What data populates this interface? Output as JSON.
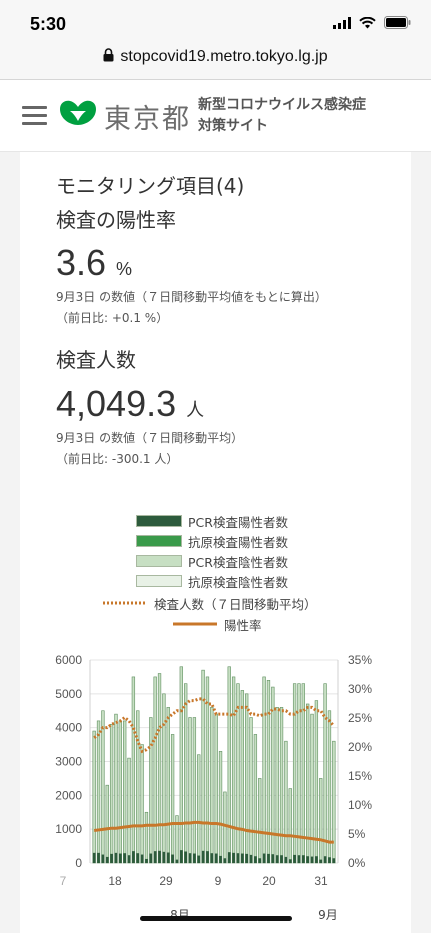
{
  "status": {
    "time": "5:30"
  },
  "browser": {
    "url": "stopcovid19.metro.tokyo.lg.jp"
  },
  "header": {
    "logo_text": "東京都",
    "site_title_line1": "新型コロナウイルス感染症",
    "site_title_line2": "対策サイト"
  },
  "card": {
    "section_title": "モニタリング項目(4)",
    "positive_rate": {
      "heading": "検査の陽性率",
      "value": "3.6",
      "unit": "%",
      "note1": "9月3日 の数値（７日間移動平均値をもとに算出）",
      "note2": "（前日比: +0.1 %）"
    },
    "tests": {
      "heading": "検査人数",
      "value": "4,049.3",
      "unit": "人",
      "note1": "9月3日 の数値（７日間移動平均）",
      "note2": "（前日比: -300.1 人）"
    }
  },
  "colors": {
    "pcr_positive": "#2d5b3c",
    "antigen_positive": "#3a9a4a",
    "pcr_negative": "#c7dfc3",
    "antigen_negative": "#e8f1e6",
    "tests_avg": "#c8772a",
    "positive_rate": "#c8772a"
  },
  "chart_data": {
    "type": "bar",
    "legend": [
      {
        "name": "PCR検査陽性者数",
        "kind": "bar",
        "color": "#2d5b3c"
      },
      {
        "name": "抗原検査陽性者数",
        "kind": "bar",
        "color": "#3a9a4a"
      },
      {
        "name": "PCR検査陰性者数",
        "kind": "bar",
        "color": "#c7dfc3"
      },
      {
        "name": "抗原検査陰性者数",
        "kind": "bar",
        "color": "#e8f1e6"
      },
      {
        "name": "検査人数（７日間移動平均）",
        "kind": "dotted-line",
        "color": "#c8772a"
      },
      {
        "name": "陽性率",
        "kind": "line",
        "color": "#c8772a"
      }
    ],
    "x_ticks": [
      "7",
      "18",
      "29",
      "9",
      "20",
      "31"
    ],
    "month_labels": [
      "8月",
      "9月"
    ],
    "y_left": {
      "min": 0,
      "max": 6000,
      "ticks": [
        "0",
        "1000",
        "2000",
        "3000",
        "4000",
        "5000",
        "6000"
      ]
    },
    "y_right": {
      "min": 0,
      "max": 35,
      "ticks": [
        "0%",
        "5%",
        "10%",
        "15%",
        "20%",
        "25%",
        "30%",
        "35%"
      ]
    },
    "daily_totals": [
      3900,
      4200,
      4500,
      2300,
      4100,
      4400,
      4200,
      4200,
      3100,
      5500,
      4500,
      3500,
      1500,
      4300,
      5500,
      5600,
      5000,
      4600,
      3800,
      1400,
      5800,
      5300,
      4300,
      4300,
      3200,
      5700,
      5500,
      4600,
      4400,
      3300,
      2100,
      5800,
      5500,
      5300,
      5100,
      5000,
      4300,
      3800,
      2500,
      5500,
      5400,
      5200,
      4600,
      4600,
      3600,
      2200,
      5300,
      5300,
      5300,
      4700,
      4400,
      4800,
      2500,
      5300,
      4500,
      3600
    ],
    "positives": [
      300,
      300,
      250,
      180,
      270,
      300,
      280,
      290,
      230,
      350,
      290,
      250,
      120,
      280,
      350,
      360,
      330,
      310,
      250,
      100,
      380,
      340,
      290,
      280,
      220,
      360,
      350,
      290,
      280,
      210,
      140,
      320,
      300,
      290,
      280,
      270,
      240,
      200,
      140,
      280,
      270,
      260,
      230,
      230,
      180,
      110,
      240,
      230,
      230,
      200,
      190,
      200,
      100,
      200,
      170,
      140
    ],
    "tests_7day_avg": [
      3700,
      3800,
      4000,
      4000,
      4100,
      4150,
      4200,
      4300,
      4200,
      4000,
      3600,
      3300,
      3350,
      3450,
      3700,
      4000,
      4100,
      4300,
      4400,
      4500,
      4500,
      4700,
      4800,
      4800,
      4850,
      4850,
      4700,
      4700,
      4400,
      4400,
      4400,
      4400,
      4350,
      4600,
      4600,
      4600,
      4400,
      4400,
      4350,
      4400,
      4400,
      4550,
      4550,
      4500,
      4500,
      4400,
      4400,
      4500,
      4500,
      4600,
      4600,
      4500,
      4500,
      4300,
      4200,
      4050
    ],
    "positive_rate_pct": [
      5.6,
      5.7,
      5.8,
      5.9,
      6.0,
      6.0,
      6.1,
      6.2,
      6.3,
      6.4,
      6.4,
      6.4,
      6.5,
      6.5,
      6.5,
      6.6,
      6.6,
      6.7,
      6.8,
      6.8,
      6.8,
      6.9,
      6.9,
      7.0,
      7.0,
      6.9,
      6.9,
      6.8,
      6.8,
      6.7,
      6.5,
      6.3,
      6.1,
      5.9,
      5.8,
      5.6,
      5.5,
      5.4,
      5.3,
      5.2,
      5.1,
      5.0,
      4.9,
      4.8,
      4.7,
      4.7,
      4.6,
      4.5,
      4.4,
      4.3,
      4.2,
      4.1,
      4.0,
      3.8,
      3.6,
      3.6
    ]
  }
}
